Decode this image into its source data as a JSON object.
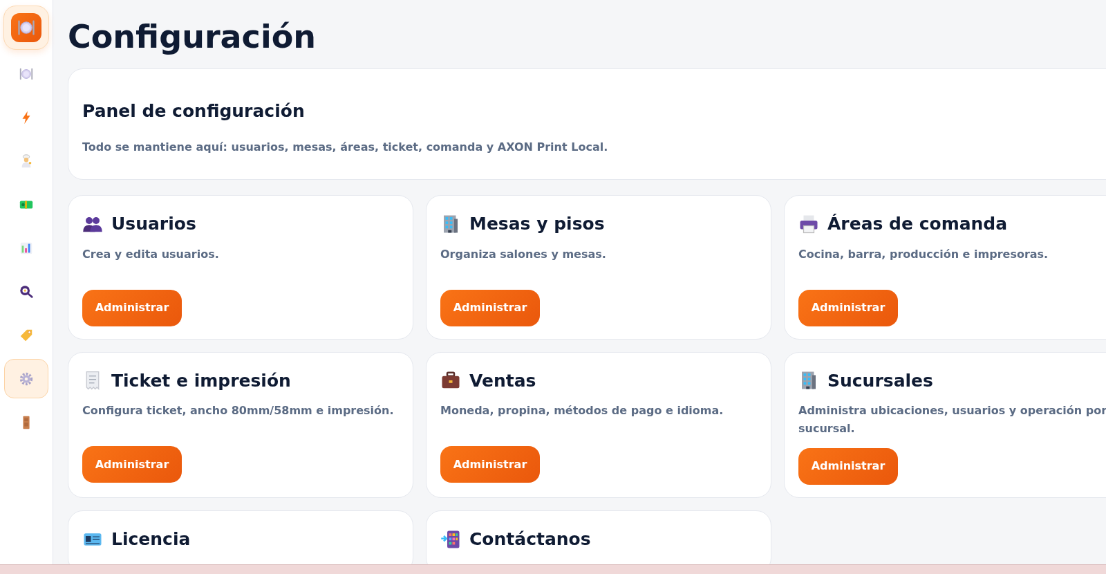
{
  "sidebar": {
    "items": [
      {
        "selected": false
      },
      {
        "selected": false
      },
      {
        "selected": false
      },
      {
        "selected": false
      },
      {
        "selected": false
      },
      {
        "selected": false
      },
      {
        "selected": false
      },
      {
        "selected": true
      },
      {
        "selected": false
      }
    ]
  },
  "page_title": "Configuración",
  "panel": {
    "title": "Panel de configuración",
    "description": "Todo se mantiene aquí: usuarios, mesas, áreas, ticket, comanda y AXON Print Local."
  },
  "cards": [
    {
      "title": "Usuarios",
      "description": "Crea y edita usuarios.",
      "button": "Administrar"
    },
    {
      "title": "Mesas y pisos",
      "description": "Organiza salones y mesas.",
      "button": "Administrar"
    },
    {
      "title": "Áreas de comanda",
      "description": "Cocina, barra, producción e impresoras.",
      "button": "Administrar"
    },
    {
      "title": "Ticket e impresión",
      "description": "Configura ticket, ancho 80mm/58mm e impresión.",
      "button": "Administrar"
    },
    {
      "title": "Ventas",
      "description": "Moneda, propina, métodos de pago e idioma.",
      "button": "Administrar"
    },
    {
      "title": "Sucursales",
      "description": "Administra ubicaciones, usuarios y operación por sucursal.",
      "button": "Administrar"
    },
    {
      "title": "Licencia"
    },
    {
      "title": "Contáctanos"
    }
  ]
}
